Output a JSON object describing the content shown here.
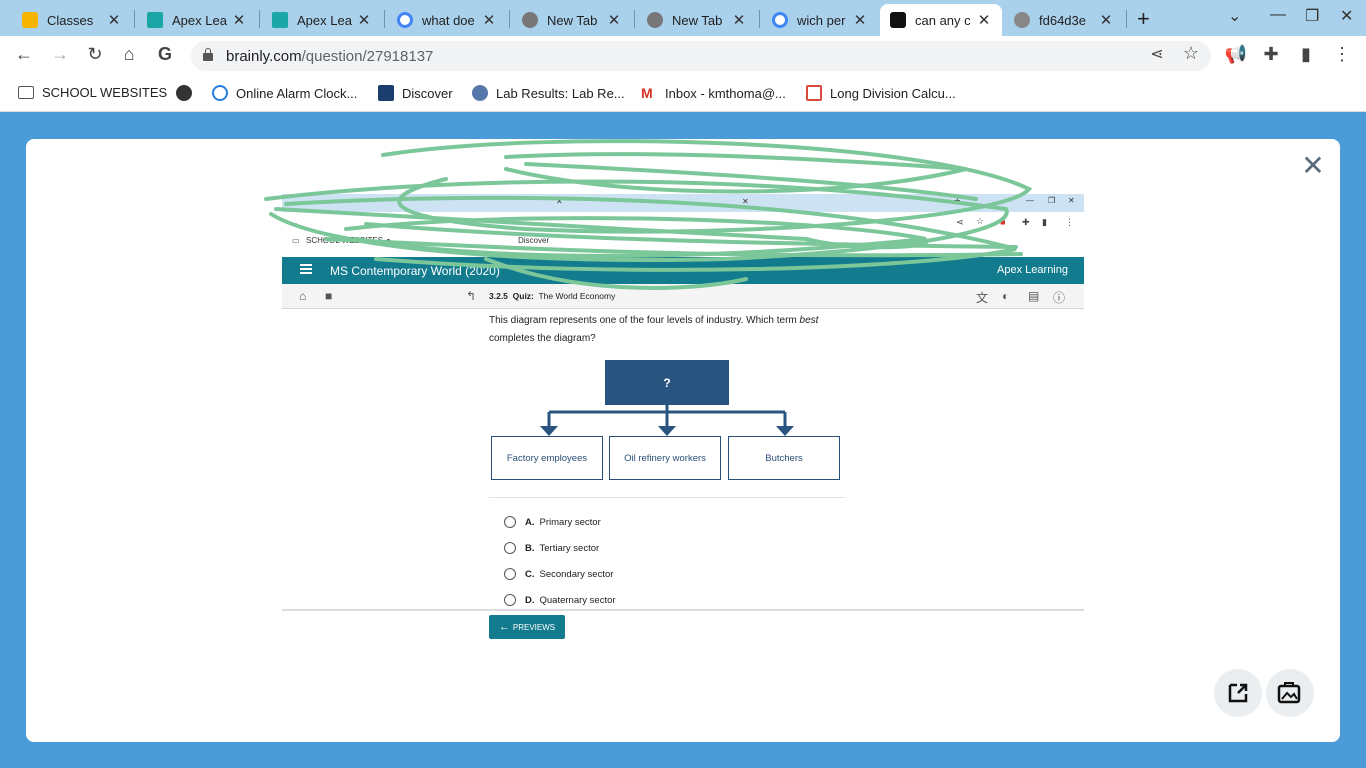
{
  "browser": {
    "tabs": [
      {
        "label": "Classes",
        "icon": "google-classroom-icon"
      },
      {
        "label": "Apex Lea",
        "icon": "apex-icon"
      },
      {
        "label": "Apex Lea",
        "icon": "apex-icon"
      },
      {
        "label": "what doe",
        "icon": "google-icon"
      },
      {
        "label": "New Tab",
        "icon": "chrome-icon"
      },
      {
        "label": "New Tab",
        "icon": "chrome-icon"
      },
      {
        "label": "wich per",
        "icon": "google-icon"
      },
      {
        "label": "can any c",
        "icon": "brainly-icon",
        "active": true
      },
      {
        "label": "fd64d3e",
        "icon": "globe-icon"
      }
    ],
    "url_host": "brainly.com",
    "url_path": "/question/27918137",
    "bookmarks": [
      {
        "label": "SCHOOL WEBSITES",
        "icon": "folder-icon"
      },
      {
        "label": "",
        "icon": "globe-icon"
      },
      {
        "label": "Online Alarm Clock...",
        "icon": "alarm-clock-icon"
      },
      {
        "label": "Discover",
        "icon": "discover-icon"
      },
      {
        "label": "Lab Results: Lab Re...",
        "icon": "lab-icon"
      },
      {
        "label": "Inbox - kmthoma@...",
        "icon": "gmail-icon"
      },
      {
        "label": "Long Division Calcu...",
        "icon": "calculator-icon"
      }
    ]
  },
  "inner": {
    "bookmarks": [
      "SCHOOL WEBSITES",
      "Discover"
    ],
    "course_title": "MS Contemporary World (2020)",
    "logo": "Apex Learning",
    "quiz_number": "3.2.5",
    "quiz_label": "Quiz:",
    "quiz_title": "The World Economy",
    "question_pre": "This diagram represents one of the four levels of industry. Which term ",
    "question_em": "best",
    "question_post": " completes the diagram?",
    "diagram": {
      "top": "?",
      "children": [
        "Factory employees",
        "Oil refinery workers",
        "Butchers"
      ]
    },
    "options": [
      {
        "letter": "A.",
        "text": "Primary sector"
      },
      {
        "letter": "B.",
        "text": "Tertiary sector"
      },
      {
        "letter": "C.",
        "text": "Secondary sector"
      },
      {
        "letter": "D.",
        "text": "Quaternary sector"
      }
    ],
    "prev_label": "PREVIEWS"
  },
  "colors": {
    "page_bg": "#4c9bd9",
    "apex_teal": "#137b8e",
    "diagram_blue": "#28547f",
    "scribble": "#7cc79a"
  }
}
